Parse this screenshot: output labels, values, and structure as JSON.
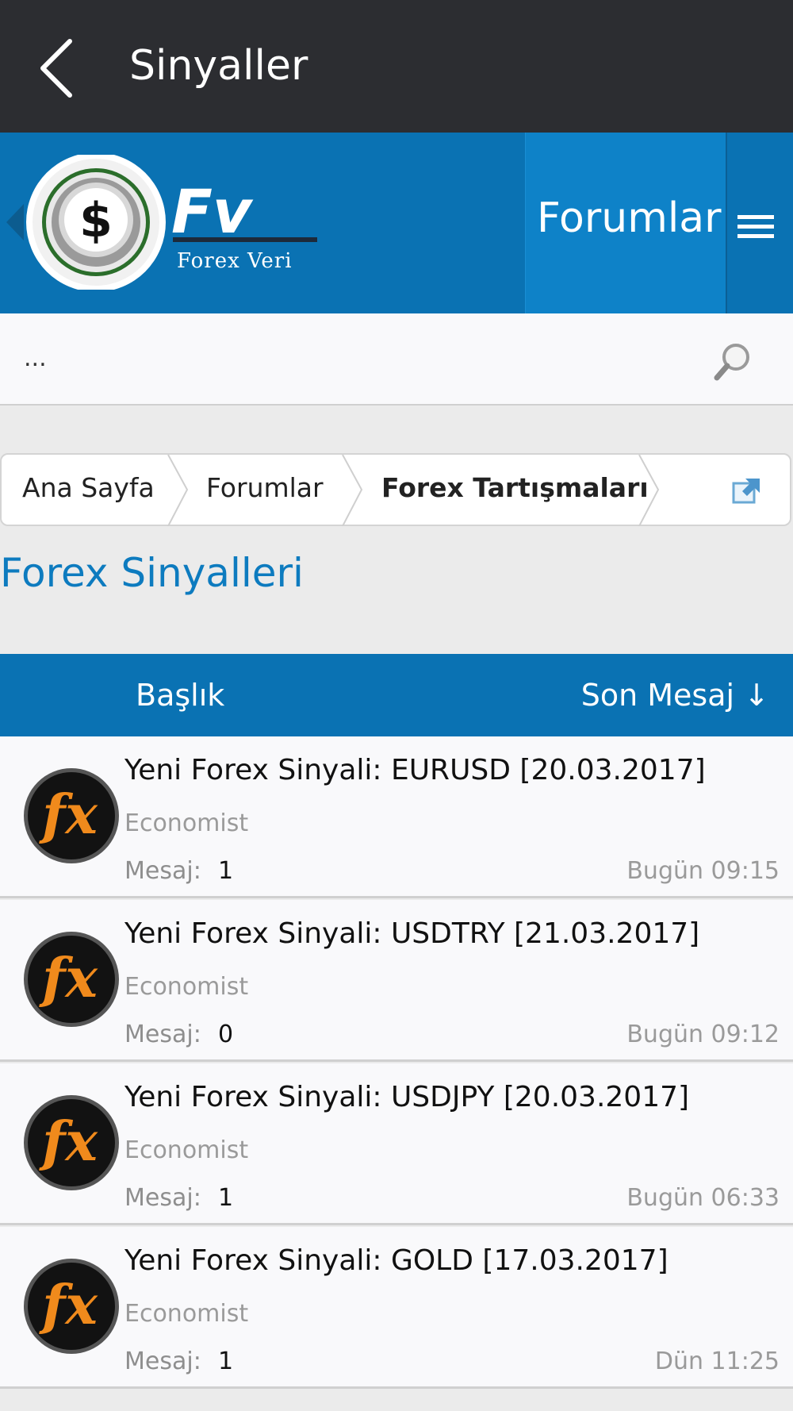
{
  "appbar": {
    "title": "Sinyaller"
  },
  "header": {
    "logo_letters": "Fv",
    "logo_text": "Forex Veri",
    "nav_tab": "Forumlar"
  },
  "search": {
    "value": "..."
  },
  "breadcrumb": {
    "items": [
      "Ana Sayfa",
      "Forumlar",
      "Forex Tartışmaları"
    ]
  },
  "forum": {
    "title": "Forex Sinyalleri"
  },
  "table": {
    "col_title": "Başlık",
    "col_last": "Son Mesaj ↓"
  },
  "threads": [
    {
      "title": "Yeni Forex Sinyali: EURUSD [20.03.2017]",
      "author": "Economist",
      "replies_label": "Mesaj:",
      "replies": "1",
      "last": "Bugün 09:15"
    },
    {
      "title": "Yeni Forex Sinyali: USDTRY [21.03.2017]",
      "author": "Economist",
      "replies_label": "Mesaj:",
      "replies": "0",
      "last": "Bugün 09:12"
    },
    {
      "title": "Yeni Forex Sinyali: USDJPY [20.03.2017]",
      "author": "Economist",
      "replies_label": "Mesaj:",
      "replies": "1",
      "last": "Bugün 06:33"
    },
    {
      "title": "Yeni Forex Sinyali: GOLD [17.03.2017]",
      "author": "Economist",
      "replies_label": "Mesaj:",
      "replies": "1",
      "last": "Dün 11:25"
    }
  ],
  "avatar_text": "fx",
  "colors": {
    "appbar": "#2c2d31",
    "brand_blue": "#0a72b3",
    "tab_blue": "#0e82c8",
    "title_blue": "#0d7bbf",
    "avatar_orange": "#f08a1c"
  }
}
